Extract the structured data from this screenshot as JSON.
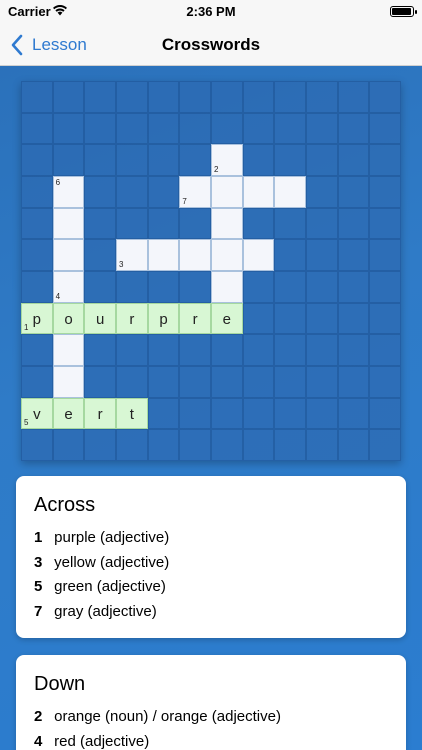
{
  "status": {
    "carrier": "Carrier",
    "time": "2:36 PM"
  },
  "nav": {
    "back_label": "Lesson",
    "title": "Crosswords"
  },
  "grid": {
    "rows": 12,
    "cols": 12,
    "cells": [
      {
        "r": 2,
        "c": 6,
        "state": "white",
        "letter": "",
        "number": "2",
        "num_pos": "bottom"
      },
      {
        "r": 3,
        "c": 5,
        "state": "white",
        "letter": "",
        "number": "7",
        "num_pos": "bottom"
      },
      {
        "r": 3,
        "c": 6,
        "state": "white",
        "letter": "",
        "number": "",
        "num_pos": ""
      },
      {
        "r": 3,
        "c": 7,
        "state": "white",
        "letter": "",
        "number": "",
        "num_pos": ""
      },
      {
        "r": 3,
        "c": 8,
        "state": "white",
        "letter": "",
        "number": "",
        "num_pos": ""
      },
      {
        "r": 3,
        "c": 1,
        "state": "white",
        "letter": "",
        "number": "6",
        "num_pos": "top"
      },
      {
        "r": 4,
        "c": 1,
        "state": "white",
        "letter": "",
        "number": "",
        "num_pos": ""
      },
      {
        "r": 4,
        "c": 6,
        "state": "white",
        "letter": "",
        "number": "",
        "num_pos": ""
      },
      {
        "r": 5,
        "c": 1,
        "state": "white",
        "letter": "",
        "number": "",
        "num_pos": ""
      },
      {
        "r": 5,
        "c": 3,
        "state": "white",
        "letter": "",
        "number": "3",
        "num_pos": "bottom"
      },
      {
        "r": 5,
        "c": 4,
        "state": "white",
        "letter": "",
        "number": "",
        "num_pos": ""
      },
      {
        "r": 5,
        "c": 5,
        "state": "white",
        "letter": "",
        "number": "",
        "num_pos": ""
      },
      {
        "r": 5,
        "c": 6,
        "state": "white",
        "letter": "",
        "number": "",
        "num_pos": ""
      },
      {
        "r": 5,
        "c": 7,
        "state": "white",
        "letter": "",
        "number": "",
        "num_pos": ""
      },
      {
        "r": 6,
        "c": 1,
        "state": "white",
        "letter": "",
        "number": "4",
        "num_pos": "bottom"
      },
      {
        "r": 6,
        "c": 6,
        "state": "white",
        "letter": "",
        "number": "",
        "num_pos": ""
      },
      {
        "r": 7,
        "c": 0,
        "state": "green",
        "letter": "p",
        "number": "1",
        "num_pos": "bottom"
      },
      {
        "r": 7,
        "c": 1,
        "state": "green",
        "letter": "o",
        "number": "",
        "num_pos": ""
      },
      {
        "r": 7,
        "c": 2,
        "state": "green",
        "letter": "u",
        "number": "",
        "num_pos": ""
      },
      {
        "r": 7,
        "c": 3,
        "state": "green",
        "letter": "r",
        "number": "",
        "num_pos": ""
      },
      {
        "r": 7,
        "c": 4,
        "state": "green",
        "letter": "p",
        "number": "",
        "num_pos": ""
      },
      {
        "r": 7,
        "c": 5,
        "state": "green",
        "letter": "r",
        "number": "",
        "num_pos": ""
      },
      {
        "r": 7,
        "c": 6,
        "state": "green",
        "letter": "e",
        "number": "",
        "num_pos": ""
      },
      {
        "r": 8,
        "c": 1,
        "state": "white",
        "letter": "",
        "number": "",
        "num_pos": ""
      },
      {
        "r": 9,
        "c": 1,
        "state": "white",
        "letter": "",
        "number": "",
        "num_pos": ""
      },
      {
        "r": 10,
        "c": 0,
        "state": "green",
        "letter": "v",
        "number": "5",
        "num_pos": "bottom"
      },
      {
        "r": 10,
        "c": 1,
        "state": "green",
        "letter": "e",
        "number": "",
        "num_pos": ""
      },
      {
        "r": 10,
        "c": 2,
        "state": "green",
        "letter": "r",
        "number": "",
        "num_pos": ""
      },
      {
        "r": 10,
        "c": 3,
        "state": "green",
        "letter": "t",
        "number": "",
        "num_pos": ""
      }
    ]
  },
  "across": {
    "title": "Across",
    "clues": [
      {
        "n": "1",
        "text": "purple (adjective)"
      },
      {
        "n": "3",
        "text": "yellow (adjective)"
      },
      {
        "n": "5",
        "text": "green (adjective)"
      },
      {
        "n": "7",
        "text": "gray (adjective)"
      }
    ]
  },
  "down": {
    "title": "Down",
    "clues": [
      {
        "n": "2",
        "text": "orange (noun) / orange (adjective)"
      },
      {
        "n": "4",
        "text": "red (adjective)"
      }
    ]
  }
}
